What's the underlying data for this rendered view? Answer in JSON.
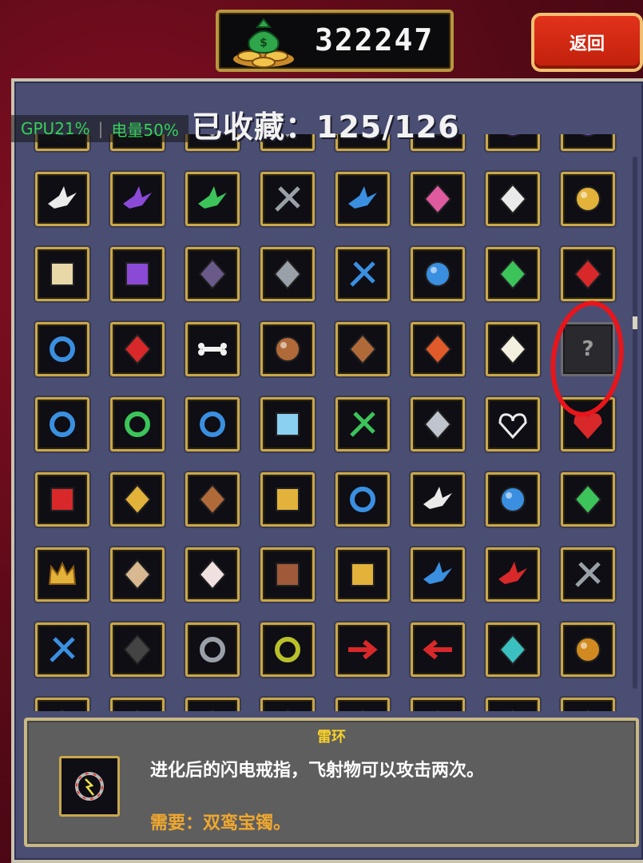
{
  "header": {
    "coin_count": "322247",
    "coin_icon": "money-bag-coins-icon",
    "back_label": "返回"
  },
  "collection": {
    "title": "已收藏：125/126"
  },
  "overlay": {
    "gpu": "GPU21%",
    "battery": "电量50%"
  },
  "grid": {
    "rows": [
      [
        "blue-gem-icon",
        "blue-crown-icon",
        "gray-shape-icon",
        "gray-shape-icon",
        "blue-wings-icon",
        "gold-frame-icon",
        "purple-orb-icon",
        "purple-gem-icon"
      ],
      [
        "white-dove-icon",
        "purple-bird-icon",
        "green-bird-icon",
        "crossed-swords-icon",
        "blue-bat-icon",
        "pink-streaks-icon",
        "white-tiger-icon",
        "golden-eye-icon"
      ],
      [
        "scroll-icon",
        "purple-grimoire-icon",
        "dark-tower-icon",
        "gray-pillar-icon",
        "blue-hook-icon",
        "blue-orb-icon",
        "green-clover-icon",
        "red-cape-icon"
      ],
      [
        "blue-swirl-ring-icon",
        "red-rose-icon",
        "bone-icon",
        "bronze-orb-icon",
        "bronze-wheel-icon",
        "flower-bouquet-icon",
        "egg-icon",
        "unknown-icon"
      ],
      [
        "blue-ring-icon",
        "green-ring-icon",
        "double-ring-icon",
        "gift-box-icon",
        "green-feather-icon",
        "armor-icon",
        "white-heart-icon",
        "red-heart-icon"
      ],
      [
        "red-tome-icon",
        "candelabra-icon",
        "gauntlet-icon",
        "gold-frame-icon",
        "sapphire-ring-icon",
        "white-wing-icon",
        "blue-sphere-icon",
        "green-clover-icon"
      ],
      [
        "gold-crown-icon",
        "mask-icon",
        "skull-icon",
        "cake-icon",
        "gold-bar-icon",
        "blue-bird-icon",
        "red-bird-icon",
        "dark-blade-icon"
      ],
      [
        "blue-blade-icon",
        "black-cat-icon",
        "gray-ring-icon",
        "olive-ring-icon",
        "red-arrow-right-icon",
        "red-arrow-left-icon",
        "crystal-icon",
        "amber-gem-icon"
      ],
      [
        "green-item-icon",
        "red-item-icon",
        "purple-item-icon",
        "gold-item-icon",
        "red-item-icon",
        "blue-item-icon",
        "teal-item-icon",
        "gold-item-icon"
      ]
    ],
    "unknown_glyph": "?"
  },
  "description": {
    "name": "雷环",
    "icon": "thunder-ring-icon",
    "text": "进化后的闪电戒指，飞射物可以攻击两次。",
    "requirement": "需要：双鸾宝镯。"
  },
  "colors": {
    "panel": "#4a4e73",
    "frame_gold": "#c9a84a",
    "back_button": "#d42a14",
    "highlight_circle": "#e8151c",
    "item_name": "#f7d02a",
    "requirement": "#f0a830"
  }
}
